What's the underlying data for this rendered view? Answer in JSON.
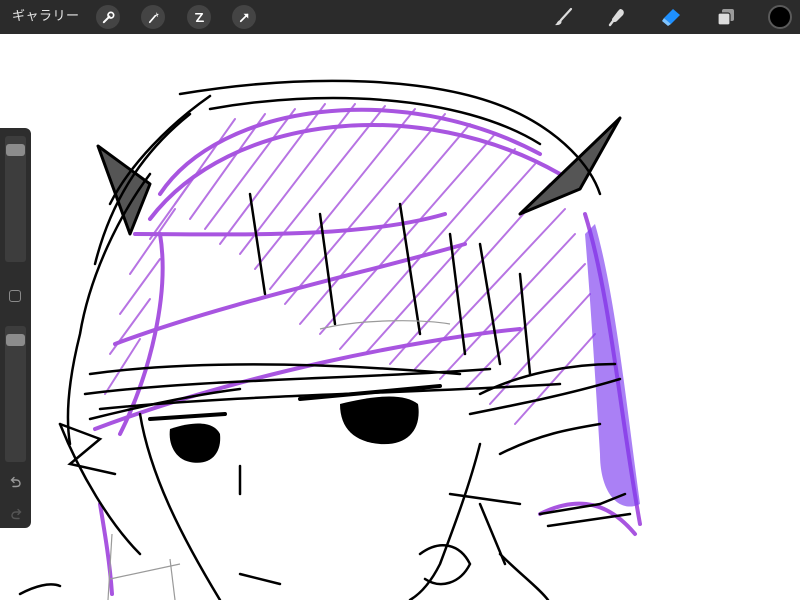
{
  "toolbar": {
    "gallery_label": "ギャラリー",
    "left_tools": [
      "wrench-icon",
      "magic-wand-icon",
      "selection-icon",
      "transform-arrow-icon"
    ],
    "right_tools": [
      "brush-icon",
      "smudge-icon",
      "eraser-icon",
      "layers-icon"
    ],
    "active_tool": "eraser-icon",
    "active_color": "#000000",
    "active_tool_color": "#1e90ff"
  },
  "sidebar": {
    "brush_size_level": 0.95,
    "opacity_level": 0.95,
    "icons": [
      "modify-square-icon",
      "undo-icon",
      "redo-icon"
    ]
  },
  "canvas": {
    "colors": {
      "line": "#000000",
      "hair": "#b066e0",
      "hair_shade": "#7d3cf0",
      "horn": "#555555"
    }
  }
}
